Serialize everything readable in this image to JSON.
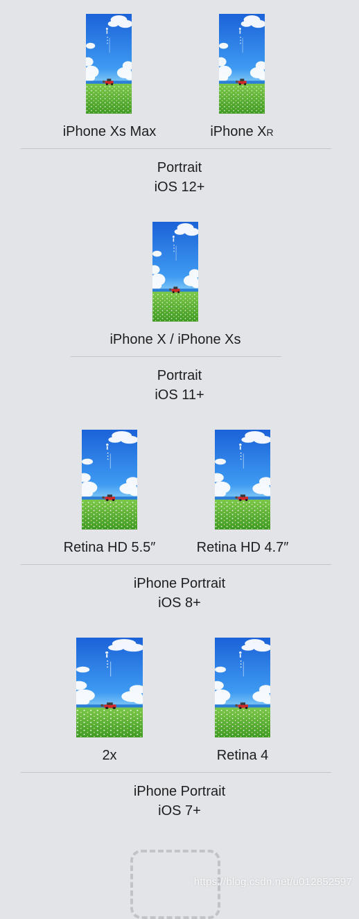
{
  "groups": [
    {
      "devices": [
        {
          "label": "iPhone Xs Max"
        },
        {
          "label": "iPhone X",
          "label_suffix": "R"
        }
      ],
      "title_line1": "Portrait",
      "title_line2": "iOS 12+"
    },
    {
      "devices": [
        {
          "label": "iPhone X / iPhone Xs"
        }
      ],
      "title_line1": "Portrait",
      "title_line2": "iOS 11+"
    },
    {
      "devices": [
        {
          "label": "Retina HD 5.5″"
        },
        {
          "label": "Retina HD 4.7″"
        }
      ],
      "title_line1": "iPhone Portrait",
      "title_line2": "iOS 8+"
    },
    {
      "devices": [
        {
          "label": "2x"
        },
        {
          "label": "Retina 4"
        }
      ],
      "title_line1": "iPhone Portrait",
      "title_line2": "iOS 7+"
    }
  ],
  "watermark": "https://blog.csdn.net/u012852597",
  "colors": {
    "background": "#e3e4e8",
    "divider": "#c4c5c9",
    "placeholder_border": "#c2c3c7"
  }
}
